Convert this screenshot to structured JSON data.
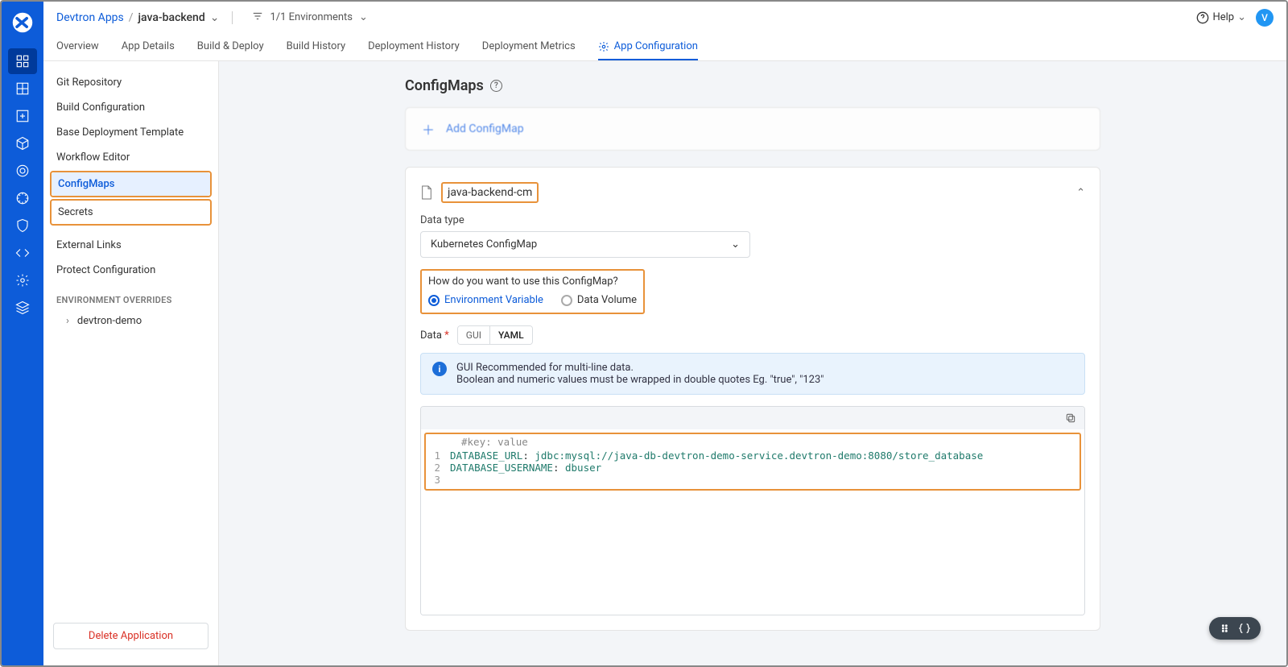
{
  "breadcrumb": {
    "parent": "Devtron Apps",
    "current": "java-backend"
  },
  "envs": {
    "label": "1/1 Environments"
  },
  "help": {
    "label": "Help"
  },
  "avatar": {
    "initial": "V"
  },
  "tabs": {
    "items": [
      "Overview",
      "App Details",
      "Build & Deploy",
      "Build History",
      "Deployment History",
      "Deployment Metrics",
      "App Configuration"
    ],
    "activeIndex": 6
  },
  "sidebar": {
    "items": [
      "Git Repository",
      "Build Configuration",
      "Base Deployment Template",
      "Workflow Editor",
      "ConfigMaps",
      "Secrets",
      "External Links",
      "Protect Configuration"
    ],
    "section": "ENVIRONMENT OVERRIDES",
    "subitem": "devtron-demo",
    "delete": "Delete Application"
  },
  "page": {
    "title": "ConfigMaps",
    "add": "Add ConfigMap"
  },
  "cm": {
    "name": "java-backend-cm",
    "datatype_label": "Data type",
    "datatype_value": "Kubernetes ConfigMap",
    "usage_q": "How do you want to use this ConfigMap?",
    "radio_env": "Environment Variable",
    "radio_vol": "Data Volume",
    "data_label": "Data",
    "toggle_gui": "GUI",
    "toggle_yaml": "YAML",
    "info_l1": "GUI Recommended for multi-line data.",
    "info_l2": "Boolean and numeric values must be wrapped in double quotes Eg. \"true\", \"123\"",
    "hint": "#key: value",
    "yaml_lines": [
      {
        "n": "1",
        "k": "DATABASE_URL",
        "v": "jdbc:mysql://java-db-devtron-demo-service.devtron-demo:8080/store_database"
      },
      {
        "n": "2",
        "k": "DATABASE_USERNAME",
        "v": "dbuser"
      },
      {
        "n": "3",
        "k": "",
        "v": ""
      }
    ]
  }
}
